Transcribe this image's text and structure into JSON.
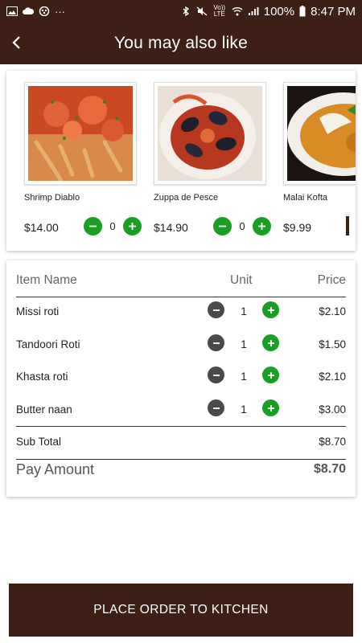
{
  "status_bar": {
    "left_icons": [
      "image-icon",
      "cloud-icon",
      "app-icon",
      "more-dots-icon"
    ],
    "right_icons": [
      "bluetooth-icon",
      "mute-icon",
      "volte-icon",
      "wifi-icon",
      "signal-icon"
    ],
    "volte_label": "Vo)) LTE",
    "battery": "100%",
    "time": "8:47 PM",
    "dots": "···"
  },
  "app_bar": {
    "title": "You may also like",
    "back_icon": "chevron-left-icon",
    "background_color": "#3d1f16"
  },
  "recommendations": [
    {
      "name": "Shrimp Diablo",
      "price": "$14.00",
      "qty": "0",
      "image": "pasta-dish"
    },
    {
      "name": "Zuppa de Pesce",
      "price": "$14.90",
      "qty": "0",
      "image": "mussel-soup"
    },
    {
      "name": "Malai Kofta",
      "price": "$9.99",
      "image": "curry-bowl"
    }
  ],
  "order": {
    "headers": {
      "name": "Item Name",
      "unit": "Unit",
      "price": "Price"
    },
    "items": [
      {
        "name": "Missi roti",
        "unit": "1",
        "price": "$2.10"
      },
      {
        "name": "Tandoori Roti",
        "unit": "1",
        "price": "$1.50"
      },
      {
        "name": "Khasta roti",
        "unit": "1",
        "price": "$2.10"
      },
      {
        "name": "Butter naan",
        "unit": "1",
        "price": "$3.00"
      }
    ],
    "subtotal_label": "Sub Total",
    "subtotal_value": "$8.70",
    "pay_label": "Pay Amount",
    "pay_value": "$8.70"
  },
  "place_order_label": "PLACE ORDER TO KITCHEN",
  "colors": {
    "brand_brown": "#3d1f16",
    "accent_green": "#1a9e24",
    "minus_gray": "#4a4a4a"
  }
}
